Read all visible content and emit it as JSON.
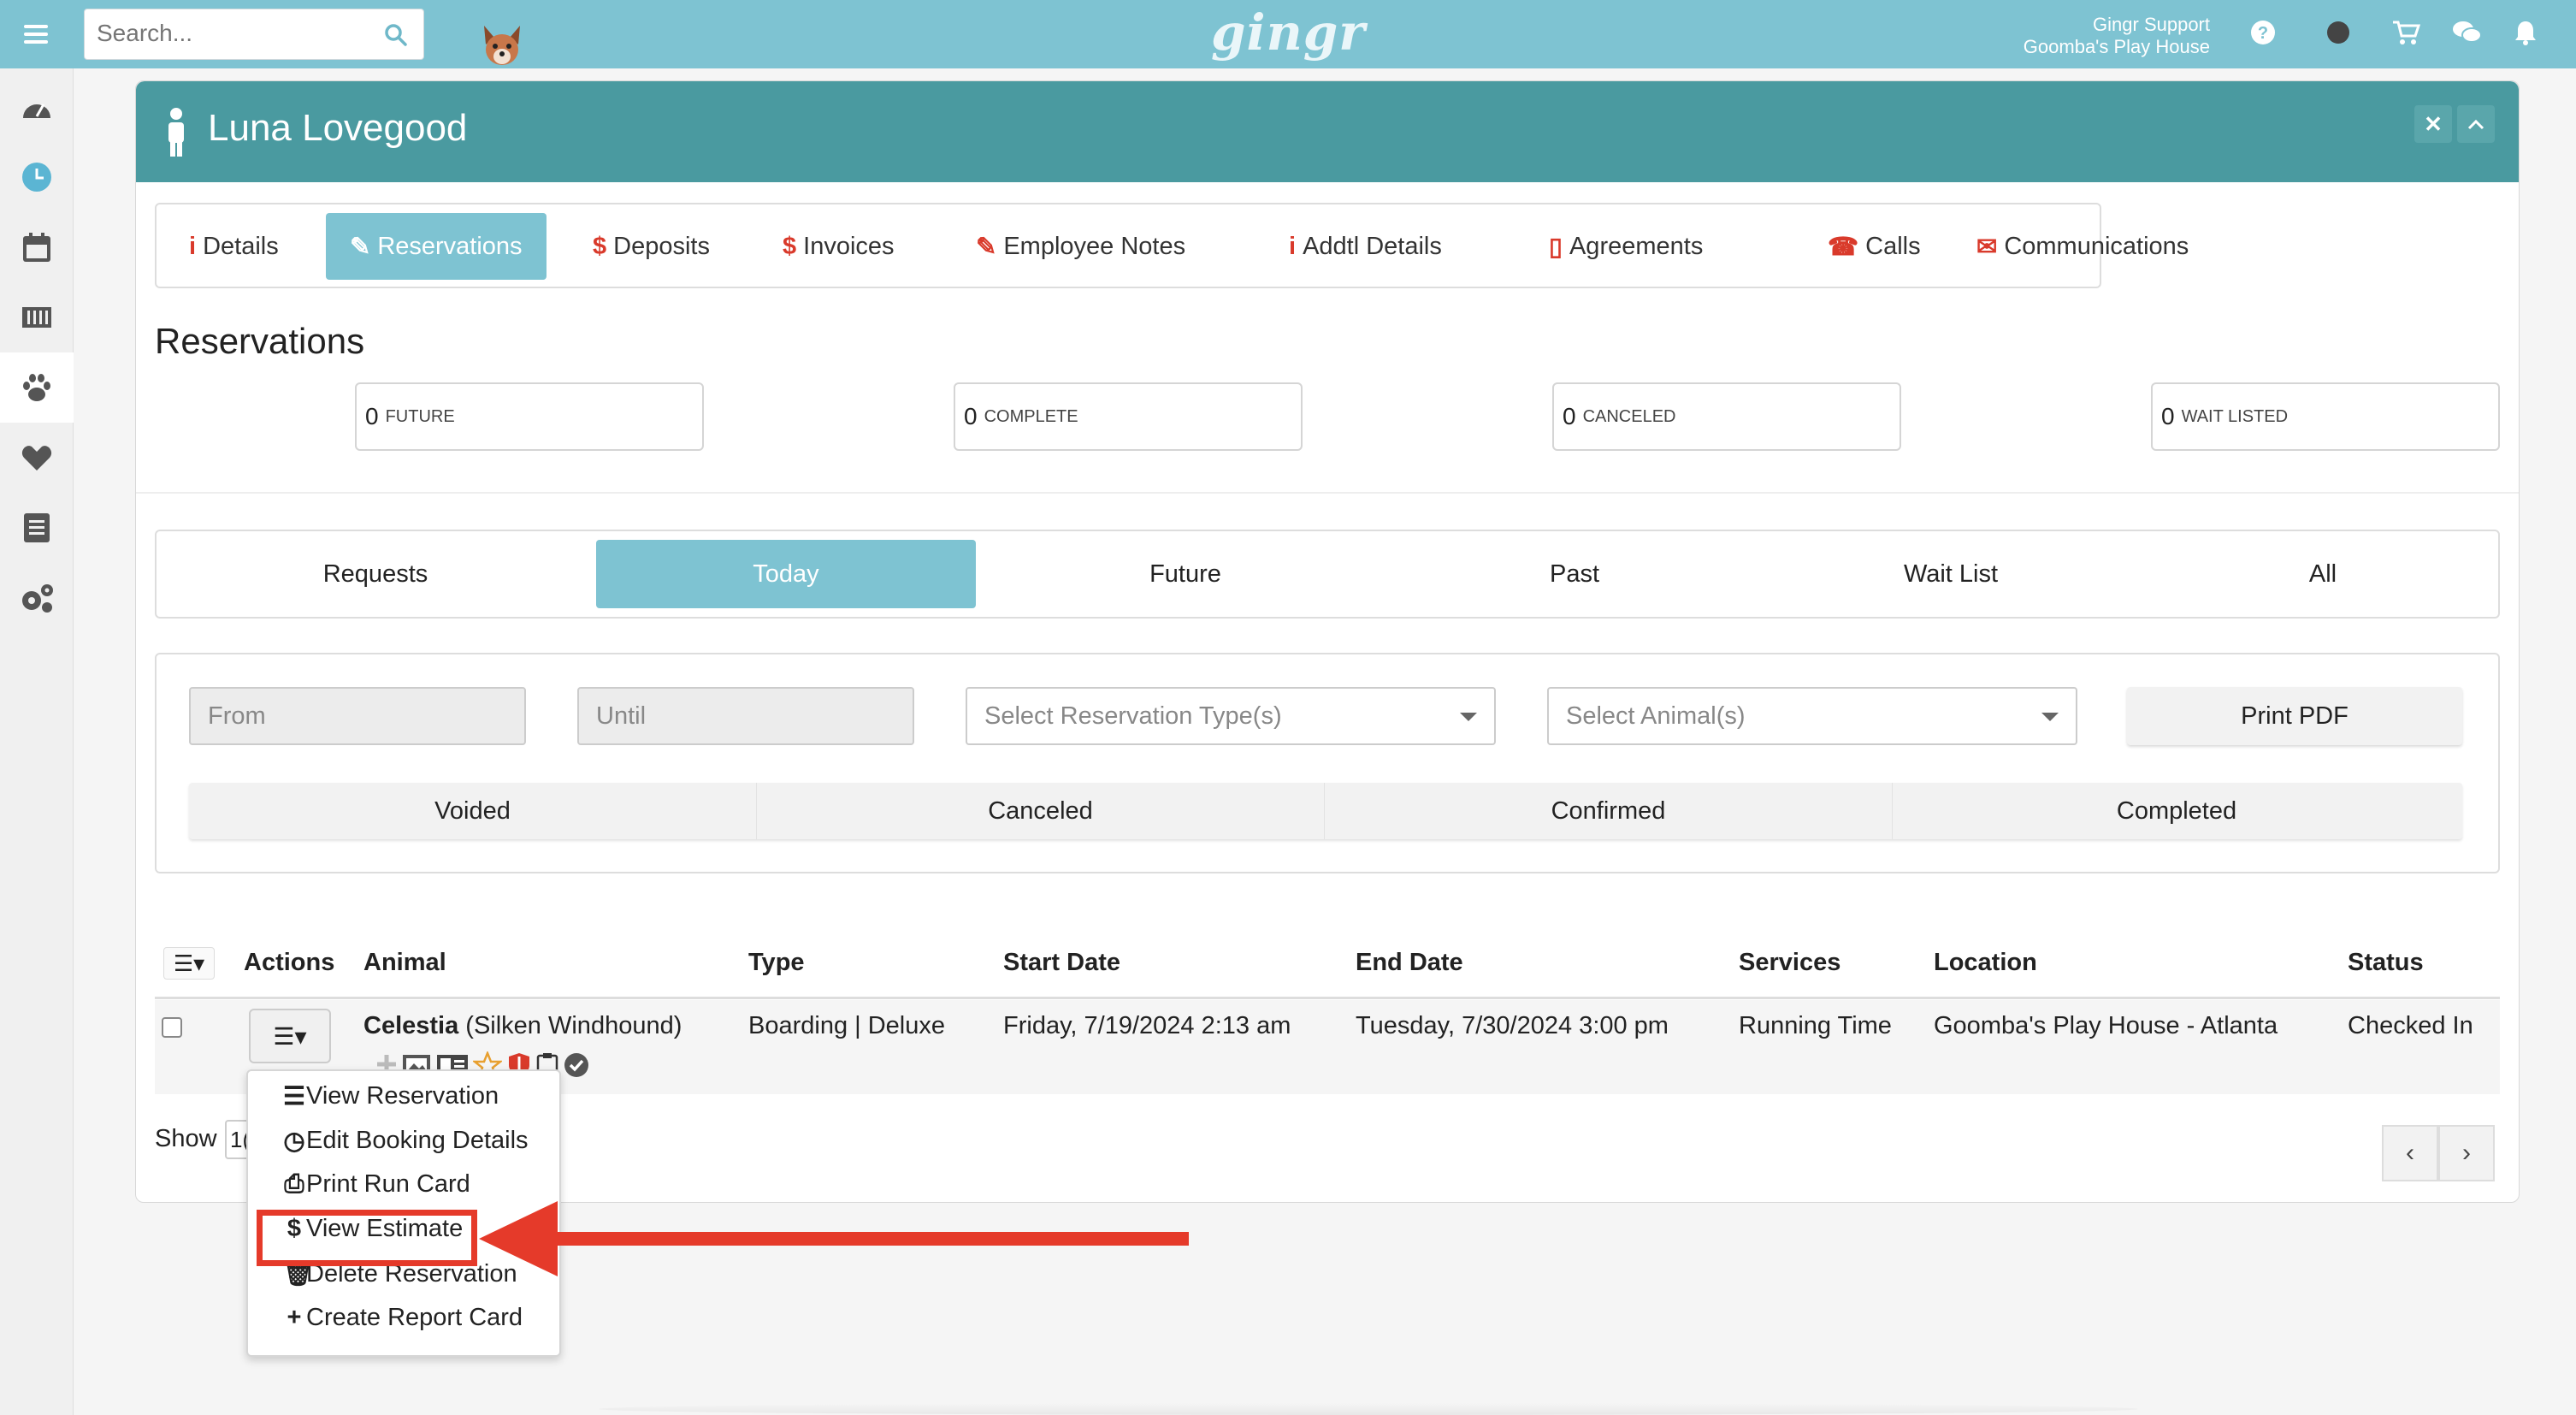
{
  "topbar": {
    "search_placeholder": "Search...",
    "logo": "gingr",
    "user_name": "Gingr Support",
    "user_location": "Goomba's Play House"
  },
  "customer": {
    "name": "Luna Lovegood"
  },
  "tabs": [
    {
      "icon": "i",
      "label": "Details"
    },
    {
      "icon": "✎",
      "label": "Reservations"
    },
    {
      "icon": "$",
      "label": "Deposits"
    },
    {
      "icon": "$",
      "label": "Invoices"
    },
    {
      "icon": "✎",
      "label": "Employee Notes"
    },
    {
      "icon": "i",
      "label": "Addtl Details"
    },
    {
      "icon": "▯",
      "label": "Agreements"
    },
    {
      "icon": "☎",
      "label": "Calls"
    },
    {
      "icon": "✉",
      "label": "Communications"
    }
  ],
  "reservations": {
    "heading": "Reservations",
    "stats": [
      {
        "count": "0",
        "label": "FUTURE"
      },
      {
        "count": "0",
        "label": "COMPLETE"
      },
      {
        "count": "0",
        "label": "CANCELED"
      },
      {
        "count": "0",
        "label": "WAIT LISTED"
      }
    ]
  },
  "filter_tabs": [
    "Requests",
    "Today",
    "Future",
    "Past",
    "Wait List",
    "All"
  ],
  "filters": {
    "from_placeholder": "From",
    "until_placeholder": "Until",
    "type_placeholder": "Select Reservation Type(s)",
    "animal_placeholder": "Select Animal(s)",
    "print_pdf": "Print PDF",
    "status_buttons": [
      "Voided",
      "Canceled",
      "Confirmed",
      "Completed"
    ]
  },
  "table": {
    "headers": [
      "Actions",
      "Animal",
      "Type",
      "Start Date",
      "End Date",
      "Services",
      "Location",
      "Status"
    ],
    "row": {
      "animal_name": "Celestia",
      "animal_breed": "(Silken Windhound)",
      "type": "Boarding | Deluxe",
      "start": "Friday, 7/19/2024 2:13 am",
      "end": "Tuesday, 7/30/2024 3:00 pm",
      "services": "Running Time",
      "location": "Goomba's Play House - Atlanta",
      "status": "Checked In"
    }
  },
  "pagination": {
    "show_label": "Show",
    "show_value": "1("
  },
  "action_menu": [
    {
      "glyph": "☰",
      "label": "View Reservation"
    },
    {
      "glyph": "◷",
      "label": "Edit Booking Details"
    },
    {
      "glyph": "⎙",
      "label": "Print Run Card"
    },
    {
      "glyph": "$",
      "label": "View Estimate"
    },
    {
      "glyph": "🗑",
      "label": "Delete Reservation"
    },
    {
      "glyph": "+",
      "label": "Create Report Card"
    }
  ],
  "colors": {
    "topbar": "#7ec3d2",
    "panel_header": "#4a9aa0",
    "accent_red": "#d93a2b",
    "highlight": "#e53a2a"
  }
}
